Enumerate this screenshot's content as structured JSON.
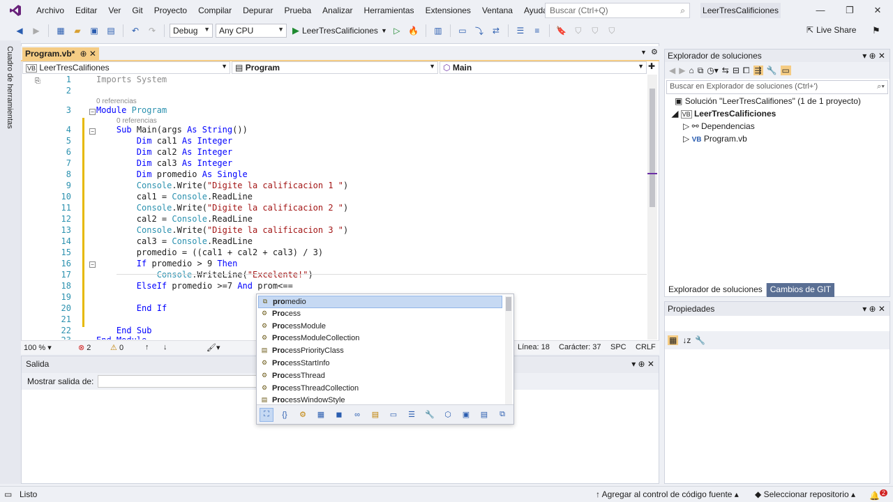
{
  "app": {
    "menu": [
      "Archivo",
      "Editar",
      "Ver",
      "Git",
      "Proyecto",
      "Compilar",
      "Depurar",
      "Prueba",
      "Analizar",
      "Herramientas",
      "Extensiones",
      "Ventana",
      "Ayuda"
    ],
    "search_placeholder": "Buscar (Ctrl+Q)",
    "solution_title": "LeerTresCalificiones",
    "live_share": "Live Share",
    "accent": "#68217a"
  },
  "toolbar": {
    "config": "Debug",
    "platform": "Any CPU",
    "run_target": "LeerTresCalificiones"
  },
  "left_tab": "Cuadro de herramientas",
  "editor": {
    "tab_label": "Program.vb*",
    "nav_project": "LeerTresCalifiones",
    "nav_class": "Program",
    "nav_member": "Main",
    "refs1": "0 referencias",
    "refs2": "0 referencias",
    "lines": [
      {
        "n": "1",
        "html": "<span class='dim'>Imports System</span>"
      },
      {
        "n": "2",
        "html": ""
      },
      {
        "n": "3",
        "html": "<span class='kw'>Module</span> <span class='ty'>Program</span>"
      },
      {
        "n": "4",
        "html": "    <span class='kw'>Sub</span> Main(args <span class='kw'>As</span> <span class='kw'>String</span>())"
      },
      {
        "n": "5",
        "html": "        <span class='kw'>Dim</span> cal1 <span class='kw'>As</span> <span class='kw'>Integer</span>"
      },
      {
        "n": "6",
        "html": "        <span class='kw'>Dim</span> cal2 <span class='kw'>As</span> <span class='kw'>Integer</span>"
      },
      {
        "n": "7",
        "html": "        <span class='kw'>Dim</span> cal3 <span class='kw'>As</span> <span class='kw'>Integer</span>"
      },
      {
        "n": "8",
        "html": "        <span class='kw'>Dim</span> promedio <span class='kw'>As</span> <span class='kw'>Single</span>"
      },
      {
        "n": "9",
        "html": "        <span class='ty'>Console</span>.Write(<span class='st'>\"Digite la calificacion 1 \"</span>)"
      },
      {
        "n": "10",
        "html": "        cal1 = <span class='ty'>Console</span>.ReadLine"
      },
      {
        "n": "11",
        "html": "        <span class='ty'>Console</span>.Write(<span class='st'>\"Digite la calificacion 2 \"</span>)"
      },
      {
        "n": "12",
        "html": "        cal2 = <span class='ty'>Console</span>.ReadLine"
      },
      {
        "n": "13",
        "html": "        <span class='ty'>Console</span>.Write(<span class='st'>\"Digite la calificacion 3 \"</span>)"
      },
      {
        "n": "14",
        "html": "        cal3 = <span class='ty'>Console</span>.ReadLine"
      },
      {
        "n": "15",
        "html": "        promedio = ((cal1 + cal2 + cal3) / 3)"
      },
      {
        "n": "16",
        "html": "        <span class='kw'>If</span> promedio > 9 <span class='kw'>Then</span>"
      },
      {
        "n": "17",
        "html": "            <span class='ty'>Console</span>.WriteLine(<span class='st'>\"Excelente!\"</span>)"
      },
      {
        "n": "18",
        "html": "        <span class='kw'>ElseIf</span> promedio >=7 <span class='kw'>And</span> prom<=="
      },
      {
        "n": "19",
        "html": ""
      },
      {
        "n": "20",
        "html": "        <span class='kw'>End</span> <span class='kw'>If</span>"
      },
      {
        "n": "21",
        "html": ""
      },
      {
        "n": "22",
        "html": "    <span class='kw'>End</span> <span class='kw'>Sub</span>"
      },
      {
        "n": "23",
        "html": "<span class='kw'>End</span> <span class='kw'>Module</span>"
      }
    ],
    "zoom": "100 %",
    "errors": "2",
    "warnings": "0",
    "line_info": "Línea: 18",
    "col_info": "Carácter: 37",
    "spc": "SPC",
    "crlf": "CRLF"
  },
  "autocomplete": {
    "typed": "pro",
    "items": [
      {
        "bold": "pro",
        "rest": "medio",
        "icon": "variable-icon"
      },
      {
        "bold": "Pro",
        "rest": "cess",
        "icon": "class-icon"
      },
      {
        "bold": "Pro",
        "rest": "cessModule",
        "icon": "class-icon"
      },
      {
        "bold": "Pro",
        "rest": "cessModuleCollection",
        "icon": "class-icon"
      },
      {
        "bold": "Pro",
        "rest": "cessPriorityClass",
        "icon": "enum-icon"
      },
      {
        "bold": "Pro",
        "rest": "cessStartInfo",
        "icon": "class-icon"
      },
      {
        "bold": "Pro",
        "rest": "cessThread",
        "icon": "class-icon"
      },
      {
        "bold": "Pro",
        "rest": "cessThreadCollection",
        "icon": "class-icon"
      },
      {
        "bold": "Pro",
        "rest": "cessWindowStyle",
        "icon": "enum-icon"
      }
    ]
  },
  "output": {
    "title": "Salida",
    "show_label": "Mostrar salida de:"
  },
  "solution_explorer": {
    "title": "Explorador de soluciones",
    "search_placeholder": "Buscar en Explorador de soluciones (Ctrl+')",
    "solution": "Solución \"LeerTresCalifiones\" (1 de 1 proyecto)",
    "project": "LeerTresCalificiones",
    "dependencies": "Dependencias",
    "file": "Program.vb",
    "tab_active": "Explorador de soluciones",
    "tab_git": "Cambios de GIT"
  },
  "properties": {
    "title": "Propiedades"
  },
  "statusbar": {
    "ready": "Listo",
    "source_control": "Agregar al control de código fuente",
    "repo": "Seleccionar repositorio",
    "notifications": "2"
  }
}
